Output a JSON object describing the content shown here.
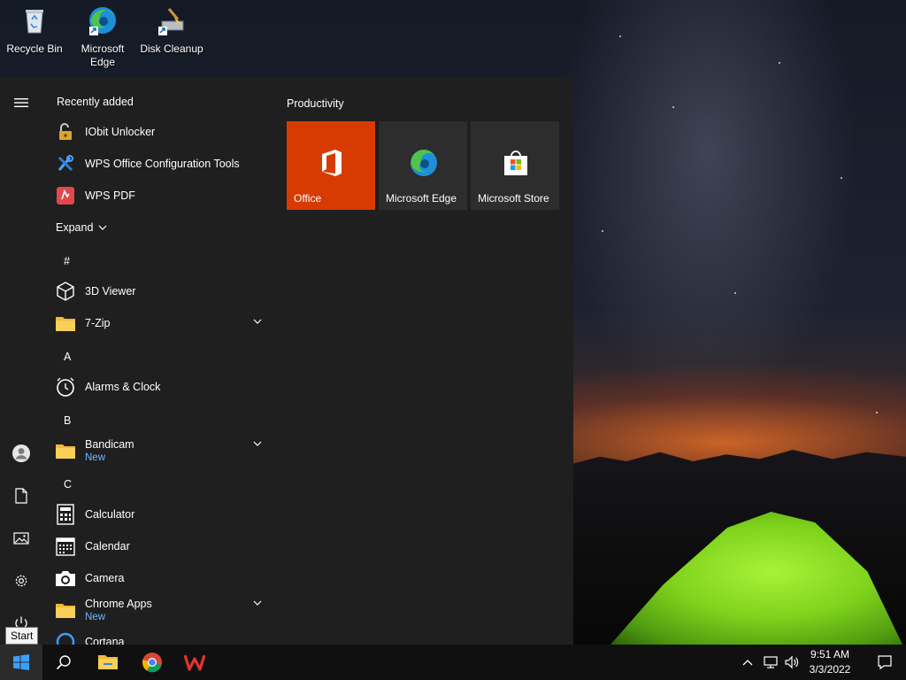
{
  "desktop": {
    "icons": [
      {
        "label": "Recycle Bin",
        "icon": "recycle-bin-icon"
      },
      {
        "label": "Microsoft Edge",
        "icon": "edge-icon"
      },
      {
        "label": "Disk Cleanup",
        "icon": "disk-cleanup-icon"
      }
    ]
  },
  "start_menu": {
    "recently_added_title": "Recently added",
    "recent_apps": [
      {
        "name": "IObit Unlocker",
        "icon": "unlocker-lock-icon"
      },
      {
        "name": "WPS Office Configuration Tools",
        "icon": "tools-icon"
      },
      {
        "name": "WPS PDF",
        "icon": "wps-pdf-icon"
      }
    ],
    "expand_label": "Expand",
    "groups": [
      {
        "letter": "#",
        "apps": [
          {
            "name": "3D Viewer",
            "icon": "cube-icon"
          },
          {
            "name": "7-Zip",
            "icon": "folder-icon",
            "expandable": true
          }
        ]
      },
      {
        "letter": "A",
        "apps": [
          {
            "name": "Alarms & Clock",
            "icon": "alarm-clock-icon"
          }
        ]
      },
      {
        "letter": "B",
        "apps": [
          {
            "name": "Bandicam",
            "sub": "New",
            "icon": "folder-icon",
            "expandable": true
          }
        ]
      },
      {
        "letter": "C",
        "apps": [
          {
            "name": "Calculator",
            "icon": "calculator-icon"
          },
          {
            "name": "Calendar",
            "icon": "calendar-icon"
          },
          {
            "name": "Camera",
            "icon": "camera-icon"
          },
          {
            "name": "Chrome Apps",
            "sub": "New",
            "icon": "folder-icon",
            "expandable": true
          },
          {
            "name": "Cortana",
            "icon": "cortana-icon"
          }
        ]
      }
    ],
    "tiles_group_title": "Productivity",
    "tiles": [
      {
        "label": "Office",
        "icon": "office-icon",
        "color": "#d83b01"
      },
      {
        "label": "Microsoft Edge",
        "icon": "edge-icon",
        "color": "#2d2d2d"
      },
      {
        "label": "Microsoft Store",
        "icon": "store-bag-icon",
        "color": "#2d2d2d"
      }
    ],
    "rail": [
      "hamburger-icon",
      "user-icon",
      "document-icon",
      "pictures-icon",
      "settings-icon",
      "power-icon"
    ]
  },
  "tooltip": {
    "text": "Start"
  },
  "taskbar": {
    "pinned": [
      "windows-start-icon",
      "search-icon",
      "file-explorer-icon",
      "chrome-icon",
      "wps-office-icon"
    ],
    "tray": {
      "time": "9:51 AM",
      "date": "3/3/2022"
    }
  },
  "colors": {
    "accent": "#0078d7",
    "office": "#d83b01",
    "menu_bg": "#1f1f1f",
    "tile_bg": "#2d2d2d",
    "new_badge": "#6cb8ff"
  }
}
